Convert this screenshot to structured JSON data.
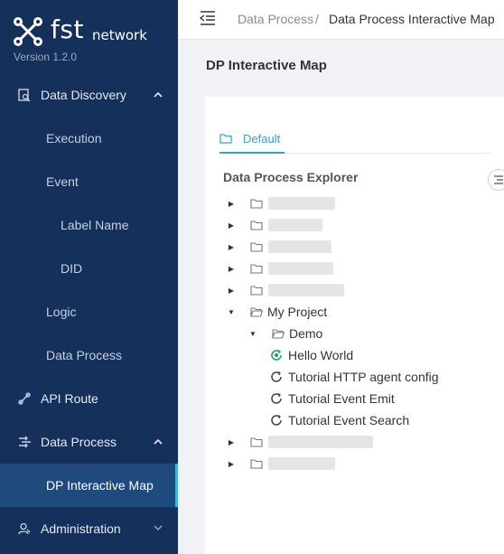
{
  "brand": {
    "logo_text": "fst",
    "logo_sub": "network",
    "version": "Version 1.2.0"
  },
  "sidebar": {
    "data_discovery": "Data Discovery",
    "execution": "Execution",
    "event": "Event",
    "label_name": "Label Name",
    "did": "DID",
    "logic": "Logic",
    "data_process_sub": "Data Process",
    "api_route": "API Route",
    "data_process": "Data Process",
    "dp_interactive_map": "DP Interactive Map",
    "administration": "Administration"
  },
  "breadcrumb": {
    "first": "Data Process",
    "separator": "/",
    "current": "Data Process Interactive Map"
  },
  "page_title": "DP Interactive Map",
  "tabs": [
    {
      "label": "Default"
    }
  ],
  "explorer": {
    "title": "Data Process Explorer",
    "project": "My Project",
    "folder": "Demo",
    "items": [
      "Hello World",
      "Tutorial HTTP agent config",
      "Tutorial Event Emit",
      "Tutorial Event Search"
    ]
  },
  "colors": {
    "sidebar": "#15305a",
    "active": "#1f4a7e",
    "accent": "#2aa6cf",
    "running": "#1aa56b"
  }
}
